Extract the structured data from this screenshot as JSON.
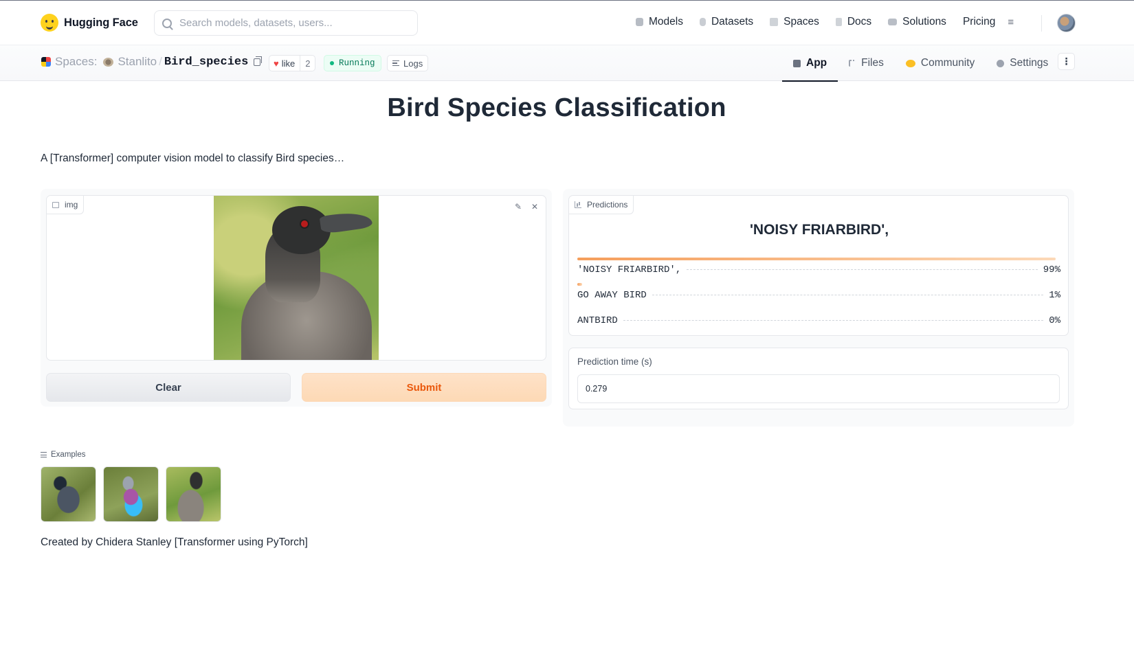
{
  "nav": {
    "brand": "Hugging Face",
    "search_placeholder": "Search models, datasets, users...",
    "links": [
      "Models",
      "Datasets",
      "Spaces",
      "Docs",
      "Solutions",
      "Pricing"
    ],
    "more_icon": "≡"
  },
  "space": {
    "section": "Spaces:",
    "owner": "Stanlito",
    "separator": "/",
    "repo": "Bird_species",
    "like_label": "like",
    "like_count": "2",
    "status": "Running",
    "logs_label": "Logs",
    "tabs": [
      "App",
      "Files",
      "Community",
      "Settings"
    ],
    "more_icon": "⋮"
  },
  "app": {
    "title": "Bird Species Classification",
    "description": "A [Transformer] computer vision model to classify Bird species…",
    "image_label": "img",
    "clear_label": "Clear",
    "submit_label": "Submit",
    "predictions_label": "Predictions",
    "top_prediction": "'NOISY FRIARBIRD',",
    "confidences": [
      {
        "label": "'NOISY FRIARBIRD',",
        "value": "99%",
        "fraction": 0.99
      },
      {
        "label": "GO AWAY BIRD",
        "value": "1%",
        "fraction": 0.01
      },
      {
        "label": "ANTBIRD",
        "value": "0%",
        "fraction": 0.0
      }
    ],
    "time_label": "Prediction time (s)",
    "time_value": "0.279",
    "examples_label": "Examples",
    "examples": [
      "quail",
      "lilac-breasted-roller",
      "noisy-friarbird"
    ],
    "footer": "Created by Chidera Stanley [Transformer using PyTorch]"
  },
  "colors": {
    "accent_orange": "#ea580c",
    "submit_bg": "#fdd9b5",
    "running_green": "#10b981",
    "heart_red": "#ef4444"
  }
}
